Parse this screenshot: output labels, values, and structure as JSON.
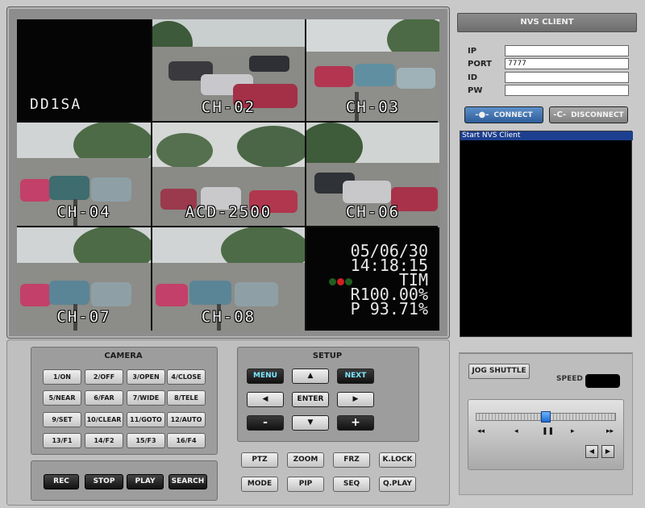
{
  "video": {
    "channels": [
      {
        "label": "DD1SA"
      },
      {
        "label": "CH-02"
      },
      {
        "label": "CH-03"
      },
      {
        "label": "CH-04"
      },
      {
        "label": "ACD-2500"
      },
      {
        "label": "CH-06"
      },
      {
        "label": "CH-07"
      },
      {
        "label": "CH-08"
      }
    ],
    "osd": {
      "date": "05/06/30",
      "time": "14:18:15",
      "mode": "TIM",
      "r_value": "R100.00%",
      "p_value": "P 93.71%"
    }
  },
  "client": {
    "title": "NVS CLIENT",
    "fields": {
      "ip_label": "IP",
      "ip_value": "",
      "port_label": "PORT",
      "port_value": "7777",
      "id_label": "ID",
      "id_value": "",
      "pw_label": "PW",
      "pw_value": ""
    },
    "connect_label": "CONNECT",
    "disconnect_label": "DISCONNECT",
    "log": [
      "Start NVS Client"
    ]
  },
  "jog": {
    "button_label": "JOG SHUTTLE",
    "speed_label": "SPEED",
    "slider_position": 0.5
  },
  "camera": {
    "title": "CAMERA",
    "buttons": [
      "1/ON",
      "2/OFF",
      "3/OPEN",
      "4/CLOSE",
      "5/NEAR",
      "6/FAR",
      "7/WIDE",
      "8/TELE",
      "9/SET",
      "10/CLEAR",
      "11/GOTO",
      "12/AUTO",
      "13/F1",
      "14/F2",
      "15/F3",
      "16/F4"
    ]
  },
  "record": {
    "buttons": [
      "REC",
      "STOP",
      "PLAY",
      "SEARCH"
    ]
  },
  "setup": {
    "title": "SETUP",
    "menu_label": "MENU",
    "next_label": "NEXT",
    "enter_label": "ENTER",
    "minus_label": "-",
    "plus_label": "+",
    "up_glyph": "▲",
    "down_glyph": "▼",
    "left_glyph": "◀",
    "right_glyph": "▶"
  },
  "functions": {
    "buttons": [
      "PTZ",
      "ZOOM",
      "FRZ",
      "K.LOCK",
      "MODE",
      "PIP",
      "SEQ",
      "Q.PLAY"
    ]
  },
  "colors": {
    "connect_accent": "#2d5d9a",
    "log_highlight": "#1d3f8f",
    "setup_highlight_text": "#7ee7ff"
  }
}
